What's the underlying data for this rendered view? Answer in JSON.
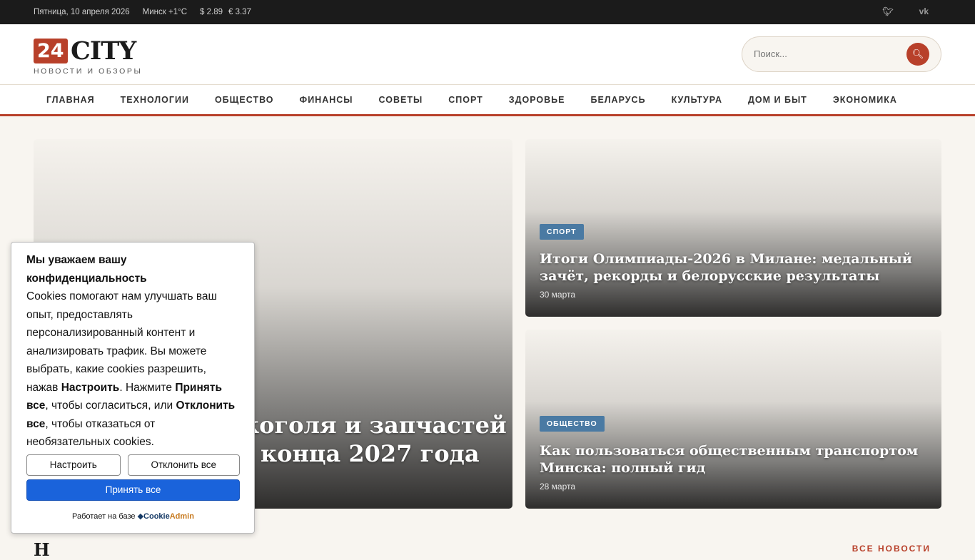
{
  "topbar": {
    "date": "Пятница, 10 апреля 2026",
    "weather": "Минск +1°C",
    "usd": "$ 2.89",
    "eur": "€ 3.37",
    "social": [
      "twitter-icon",
      "vk-icon"
    ]
  },
  "logo": {
    "number": "24",
    "name": "CITY",
    "tagline": "НОВОСТИ И ОБЗОРЫ"
  },
  "search": {
    "placeholder": "Поиск..."
  },
  "nav": [
    "ГЛАВНАЯ",
    "ТЕХНОЛОГИИ",
    "ОБЩЕСТВО",
    "ФИНАНСЫ",
    "СОВЕТЫ",
    "СПОРТ",
    "ЗДОРОВЬЕ",
    "БЕЛАРУСЬ",
    "КУЛЬТУРА",
    "ДОМ И БЫТ",
    "ЭКОНОМИКА"
  ],
  "featured": {
    "title_line1": "коголя и запчастей из",
    "title_line2": "конца 2027 года"
  },
  "side": [
    {
      "category": "СПОРТ",
      "title": "Итоги Олимпиады-2026 в Милане: медальный зачёт, рекорды и белорусские результаты",
      "date": "30 марта"
    },
    {
      "category": "ОБЩЕСТВО",
      "title": "Как пользоваться общественным транспортом Минска: полный гид",
      "date": "28 марта"
    }
  ],
  "section": {
    "title": "Н",
    "all": "ВСЕ НОВОСТИ"
  },
  "cookie": {
    "heading": "Мы уважаем вашу конфиденциальность",
    "text1": "Cookies помогают нам улучшать ваш опыт, предоставлять персонализированный контент и анализировать трафик. Вы можете выбрать, какие cookies разрешить, нажав ",
    "b1": "Настроить",
    "text2": ". Нажмите ",
    "b2": "Принять все",
    "text3": ", чтобы согласиться, или ",
    "b3": "Отклонить все",
    "text4": ", чтобы отказаться от необязательных cookies.",
    "customize": "Настроить",
    "reject": "Отклонить все",
    "accept": "Принять все",
    "powered": "Работает на базе",
    "brand1": "Cookie",
    "brand2": "Admin"
  }
}
